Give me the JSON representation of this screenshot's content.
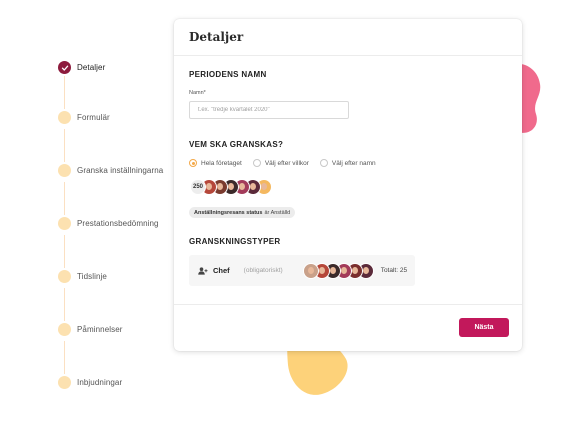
{
  "stepper": {
    "steps": [
      {
        "label": "Detaljer",
        "state": "done"
      },
      {
        "label": "Formulär",
        "state": "pending"
      },
      {
        "label": "Granska inställningarna",
        "state": "pending"
      },
      {
        "label": "Prestationsbedömning",
        "state": "pending"
      },
      {
        "label": "Tidslinje",
        "state": "pending"
      },
      {
        "label": "Påminnelser",
        "state": "pending"
      },
      {
        "label": "Inbjudningar",
        "state": "pending"
      }
    ],
    "colors": {
      "done": "#8d1b3d",
      "pending": "#fce1b0",
      "line": "#fbe0c2"
    }
  },
  "card": {
    "title": "Detaljer",
    "period": {
      "heading": "PERIODENS NAMN",
      "field_label": "Namn*",
      "value": "",
      "placeholder": "t.ex. \"tredje kvartalet 2020\""
    },
    "reviewers": {
      "heading": "VEM SKA GRANSKAS?",
      "options": [
        {
          "label": "Hela företaget",
          "selected": true
        },
        {
          "label": "Välj efter villkor",
          "selected": false
        },
        {
          "label": "Välj efter namn",
          "selected": false
        }
      ],
      "count": "250",
      "avatar_colors": [
        "#b5473a",
        "#7a3b2e",
        "#3b2a2a",
        "#a33b5a",
        "#5b2a3a",
        "#f4b860"
      ],
      "filter": {
        "key": "Anställningsresans status",
        "rest": "är Anställd"
      }
    },
    "review_types": {
      "heading": "GRANSKNINGSTYPER",
      "row": {
        "icon": "user-add-icon",
        "role": "Chef",
        "note": "(obligatoriskt)",
        "avatar_colors": [
          "#c9a18a",
          "#b5473a",
          "#3b2a2a",
          "#a33b5a",
          "#7a2e2e",
          "#5b2a3a"
        ],
        "total": "Totalt: 25"
      }
    },
    "footer": {
      "next_label": "Nästa"
    }
  },
  "decor": {
    "pink": "#f06a8c",
    "yellow": "#fdd27a",
    "accent": "#c2185b"
  }
}
